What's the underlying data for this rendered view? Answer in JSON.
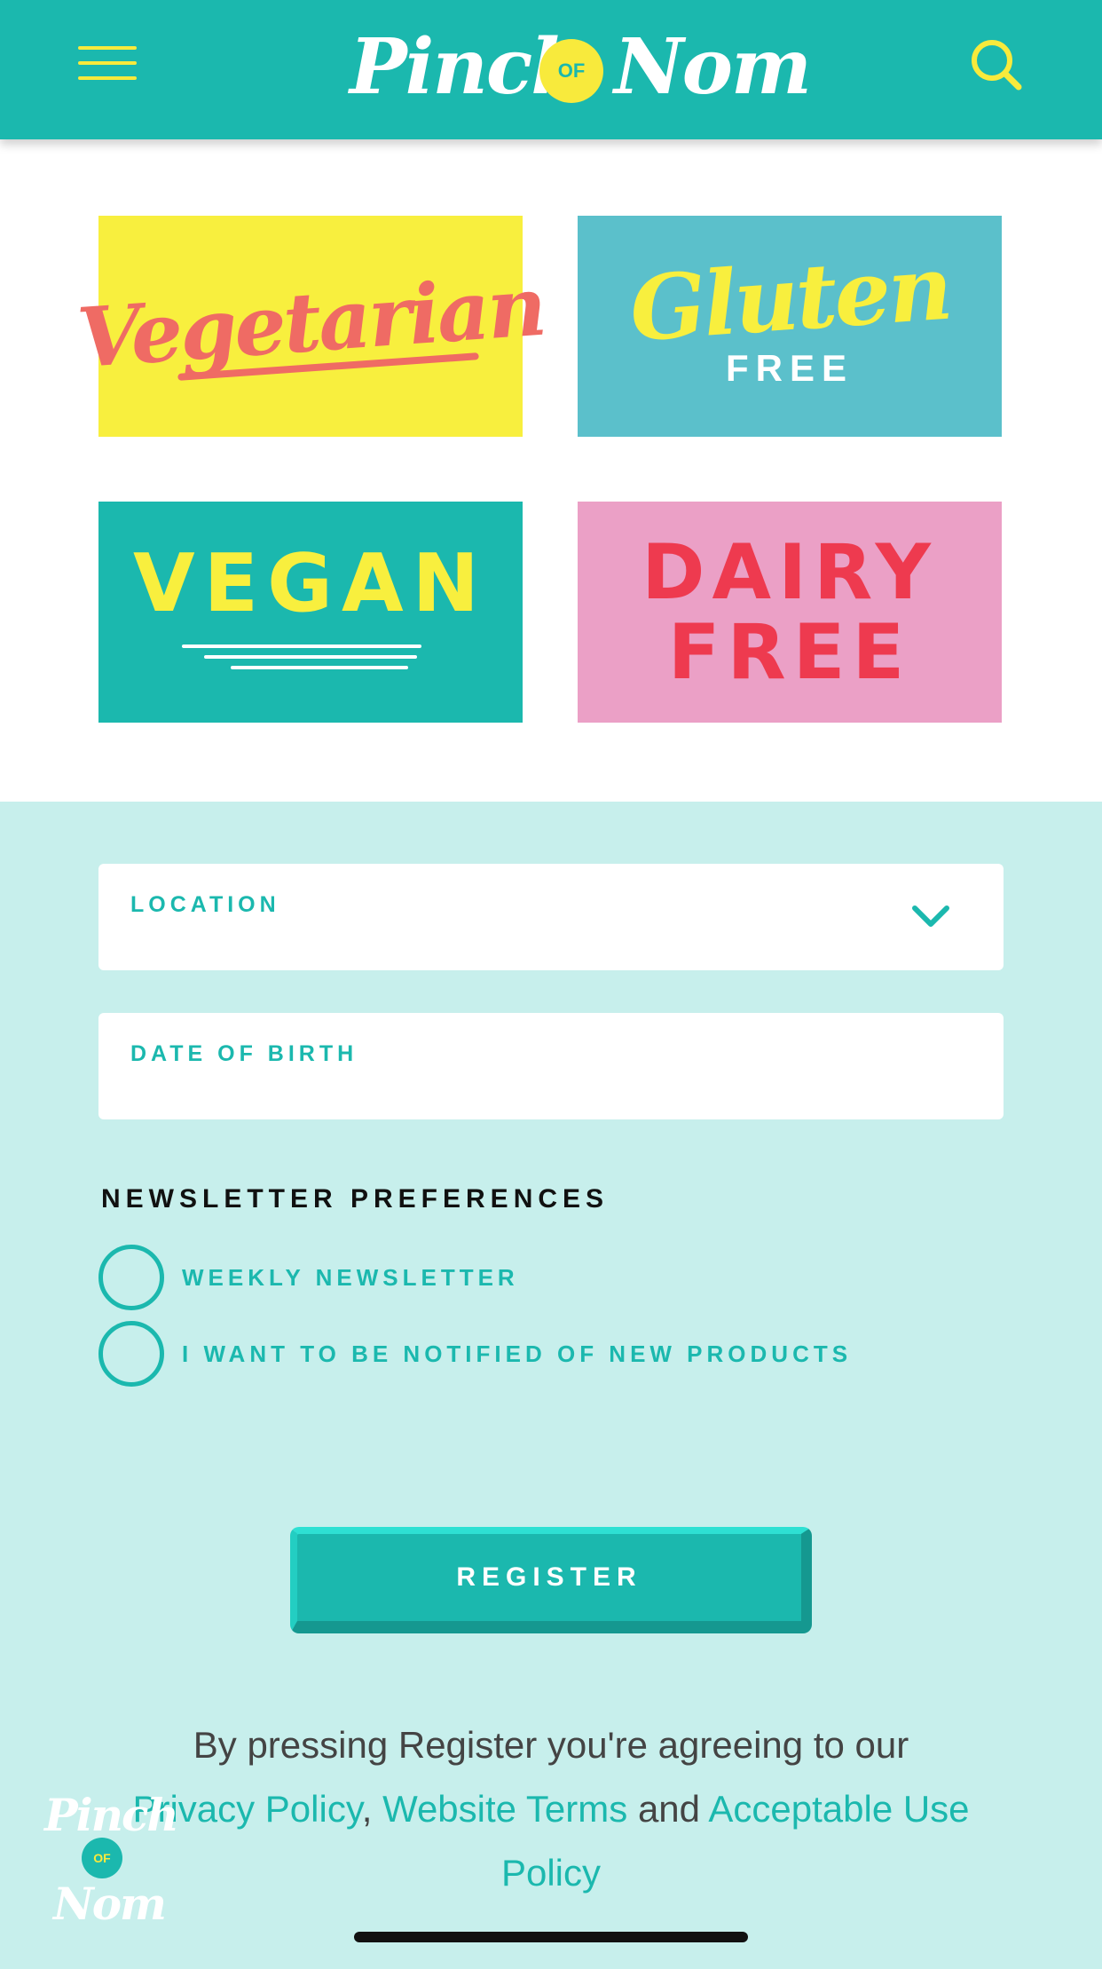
{
  "header": {
    "logo_left": "Pinch",
    "logo_middle": "OF",
    "logo_right": "Nom",
    "menu_icon": "hamburger-menu-icon",
    "search_icon": "search-icon",
    "background_color": "#1bb8ae",
    "icon_color": "#f8ea3c"
  },
  "diet_tiles": [
    {
      "title": "Vegetarian",
      "subtitle": "",
      "bg": "#f8ef3e",
      "text_color": "#ef6b64"
    },
    {
      "title": "Gluten",
      "subtitle": "FREE",
      "bg": "#5bc0cb",
      "text_color": "#f8ef3e"
    },
    {
      "title": "VEGAN",
      "subtitle": "",
      "bg": "#1bb8ae",
      "text_color": "#f8ef3e"
    },
    {
      "title_line1": "DAIRY",
      "title_line2": "FREE",
      "bg": "#eba0c6",
      "text_color": "#ee3a4f"
    }
  ],
  "form": {
    "location_label": "LOCATION",
    "location_value": "",
    "dob_label": "DATE OF BIRTH",
    "dob_value": "",
    "newsletter_title": "NEWSLETTER PREFERENCES",
    "options": [
      {
        "label": "WEEKLY NEWSLETTER",
        "checked": false
      },
      {
        "label": "I WANT TO BE NOTIFIED OF NEW PRODUCTS",
        "checked": false
      }
    ],
    "register_label": "REGISTER"
  },
  "legal": {
    "prefix": "By pressing Register you're agreeing to our",
    "privacy_policy": "Privacy Policy",
    "comma": ",",
    "website_terms": "Website Terms",
    "and": "and",
    "acceptable_use": "Acceptable Use Policy"
  },
  "corner_logo": {
    "pinch": "Pinch",
    "of": "OF",
    "nom": "Nom"
  },
  "colors": {
    "brand_teal": "#1bb8ae",
    "brand_yellow": "#f8ea3c",
    "page_bg": "#c7efec"
  }
}
